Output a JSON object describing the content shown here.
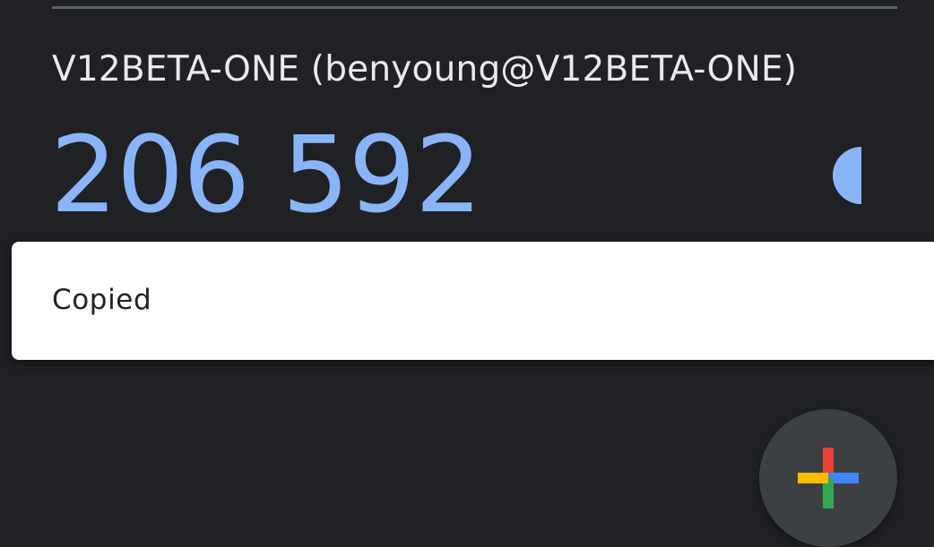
{
  "account": {
    "name": "V12BETA-ONE (benyoung@V12BETA-ONE)"
  },
  "otp": {
    "code": "206 592",
    "timer_remaining_fraction": 0.45
  },
  "snackbar": {
    "message": "Copied"
  },
  "fab": {
    "icon": "google-plus-icon"
  },
  "colors": {
    "background": "#202124",
    "code": "#8ab4f8",
    "account_text": "#e8eaed",
    "snackbar_bg": "#ffffff",
    "fab_bg": "#3c4043",
    "plus_red": "#ea4335",
    "plus_blue": "#4285f4",
    "plus_green": "#34a853",
    "plus_yellow": "#fbbc04"
  }
}
